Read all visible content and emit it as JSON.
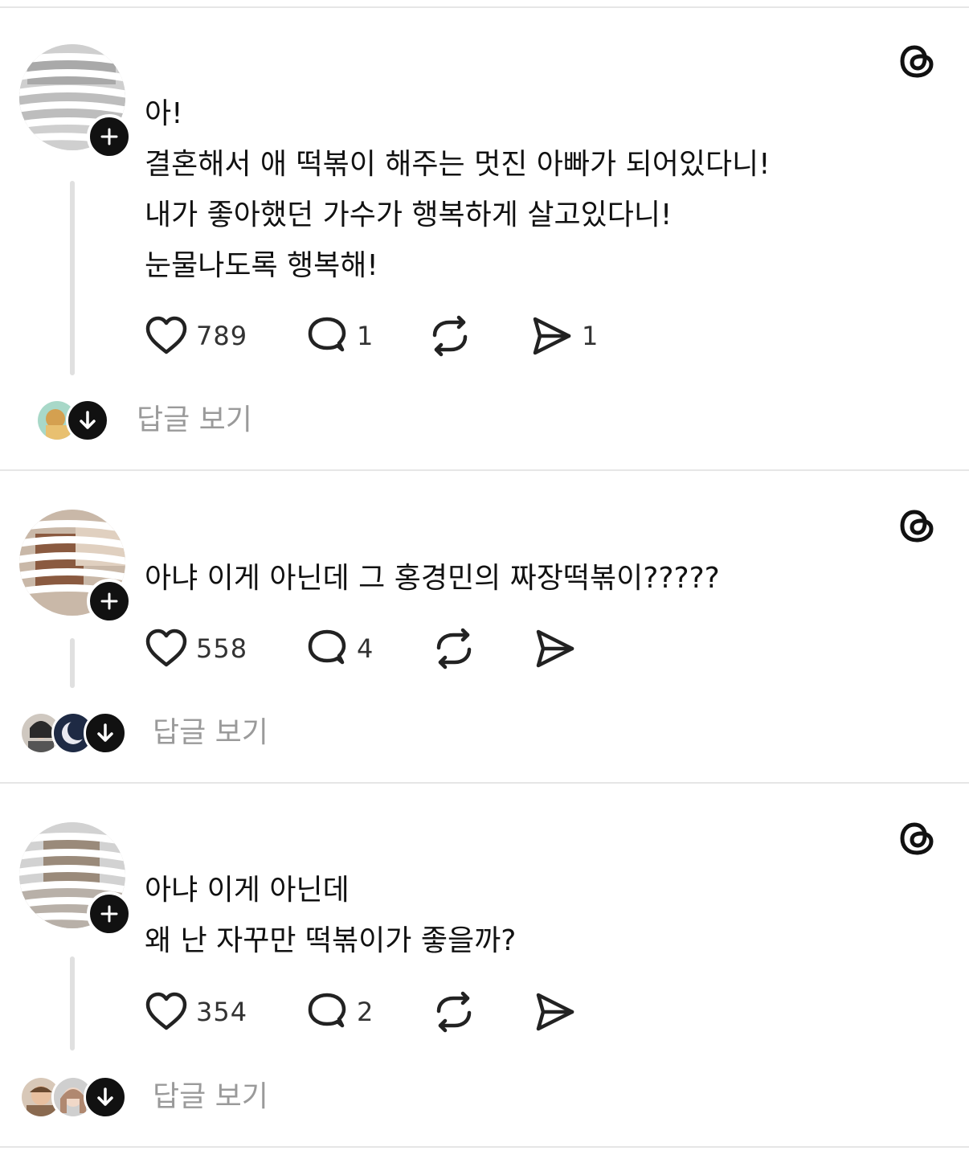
{
  "posts": [
    {
      "lines": [
        "아!",
        "결혼해서 애 떡볶이 해주는 멋진 아빠가 되어있다니!",
        "내가 좋아했던 가수가 행복하게 살고있다니!",
        "눈물나도록 행복해!"
      ],
      "likes": "789",
      "comments": "1",
      "shares": "1",
      "view_replies": "답글 보기"
    },
    {
      "lines": [
        "아냐 이게 아닌데 그 홍경민의 짜장떡볶이?????"
      ],
      "likes": "558",
      "comments": "4",
      "shares": "",
      "view_replies": "답글 보기"
    },
    {
      "lines": [
        "아냐 이게 아닌데",
        "왜 난 자꾸만 떡볶이가 좋을까?"
      ],
      "likes": "354",
      "comments": "2",
      "shares": "",
      "view_replies": "답글 보기"
    }
  ],
  "icons": {
    "app_logo": "threads-logo-icon",
    "follow": "plus-icon",
    "like": "heart-icon",
    "comment": "comment-bubble-icon",
    "repost": "repost-icon",
    "share": "send-icon",
    "expand": "arrow-down-icon"
  },
  "colors": {
    "text": "#111111",
    "muted": "#9a9a9a",
    "divider": "#e6e6e6",
    "thread_line": "#e0e0e0"
  }
}
